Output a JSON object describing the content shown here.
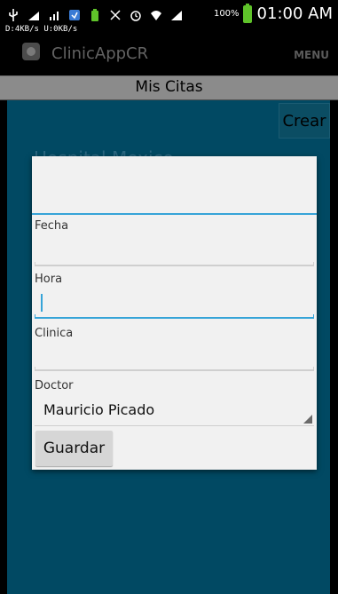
{
  "status_bar": {
    "speed_text": "D:4KB/s   U:0KB/s",
    "battery_percent": "100%",
    "time": "01:00 AM",
    "icons": [
      "usb-icon",
      "signal-icon",
      "signal-bars-icon",
      "shield-icon",
      "battery-saver-icon",
      "nfc-icon",
      "alarm-icon",
      "wifi-icon",
      "cell-signal-icon",
      "battery-icon"
    ]
  },
  "action_bar": {
    "app_name": "ClinicAppCR",
    "menu_label": "MENU"
  },
  "screen": {
    "title": "Mis Citas",
    "create_button": "Crear",
    "list_item": "Hospital Mexico"
  },
  "dialog": {
    "first_field_value": "",
    "fields": [
      {
        "label": "Fecha",
        "value": ""
      },
      {
        "label": "Hora",
        "value": ""
      },
      {
        "label": "Clinica",
        "value": ""
      }
    ],
    "doctor_label": "Doctor",
    "doctor_selected": "Mauricio Picado",
    "save_button": "Guardar"
  },
  "colors": {
    "background": "#014963",
    "accent": "#36a4d8",
    "title_bar": "#8b8b8b",
    "battery": "#5fc32a"
  }
}
